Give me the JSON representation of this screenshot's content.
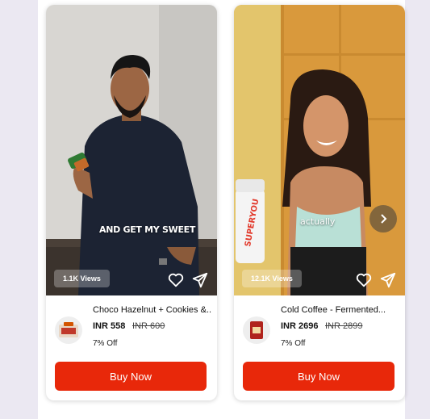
{
  "cards": [
    {
      "views": "1.1K Views",
      "caption": "AND GET MY SWEET",
      "product_name": "Choco Hazelnut + Cookies &...",
      "price": "INR 558",
      "mrp": "INR 600",
      "discount": "7% Off",
      "buy_label": "Buy Now"
    },
    {
      "views": "12.1K Views",
      "caption": "actually",
      "bottle_text": "SUPERYOU",
      "product_name": "Cold Coffee - Fermented...",
      "price": "INR 2696",
      "mrp": "INR 2899",
      "discount": "7% Off",
      "buy_label": "Buy Now"
    }
  ],
  "colors": {
    "buy_button": "#e8280a",
    "page_background": "#ebe8f2"
  },
  "icons": [
    "heart-icon",
    "share-icon",
    "chevron-right-icon"
  ]
}
